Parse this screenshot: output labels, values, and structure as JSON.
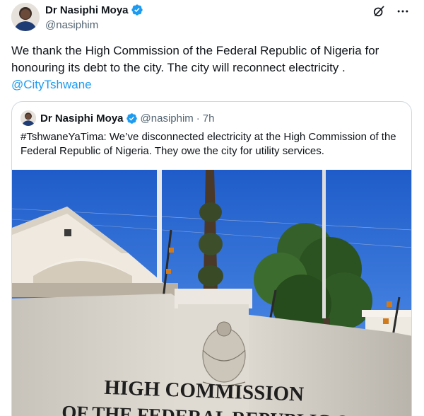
{
  "post": {
    "author_name": "Dr Nasiphi Moya",
    "author_handle": "@nasiphim",
    "text": "We thank the High Commission of the Federal Republic of Nigeria for honouring its debt to the city. The city will reconnect electricity .",
    "mention": "@CityTshwane",
    "icons": {
      "verified": "verified-badge-icon",
      "grok": "grok-icon",
      "more": "more-icon"
    }
  },
  "quote": {
    "author_name": "Dr Nasiphi Moya",
    "author_handle": "@nasiphim",
    "separator": "·",
    "time": "7h",
    "text": "#TshwaneYaTima: We’ve disconnected electricity at the High Commission of the Federal Republic of Nigeria. They owe the city for utility services.",
    "image": {
      "sign_line1": "HIGH COMMISSION",
      "sign_line2": "OF THE FEDERAL REPUBLIC OF"
    }
  },
  "colors": {
    "text": "#0f1419",
    "secondary": "#536471",
    "accent": "#1d9bf0",
    "border": "#cfd9de",
    "sky": "#2f6fd6"
  }
}
